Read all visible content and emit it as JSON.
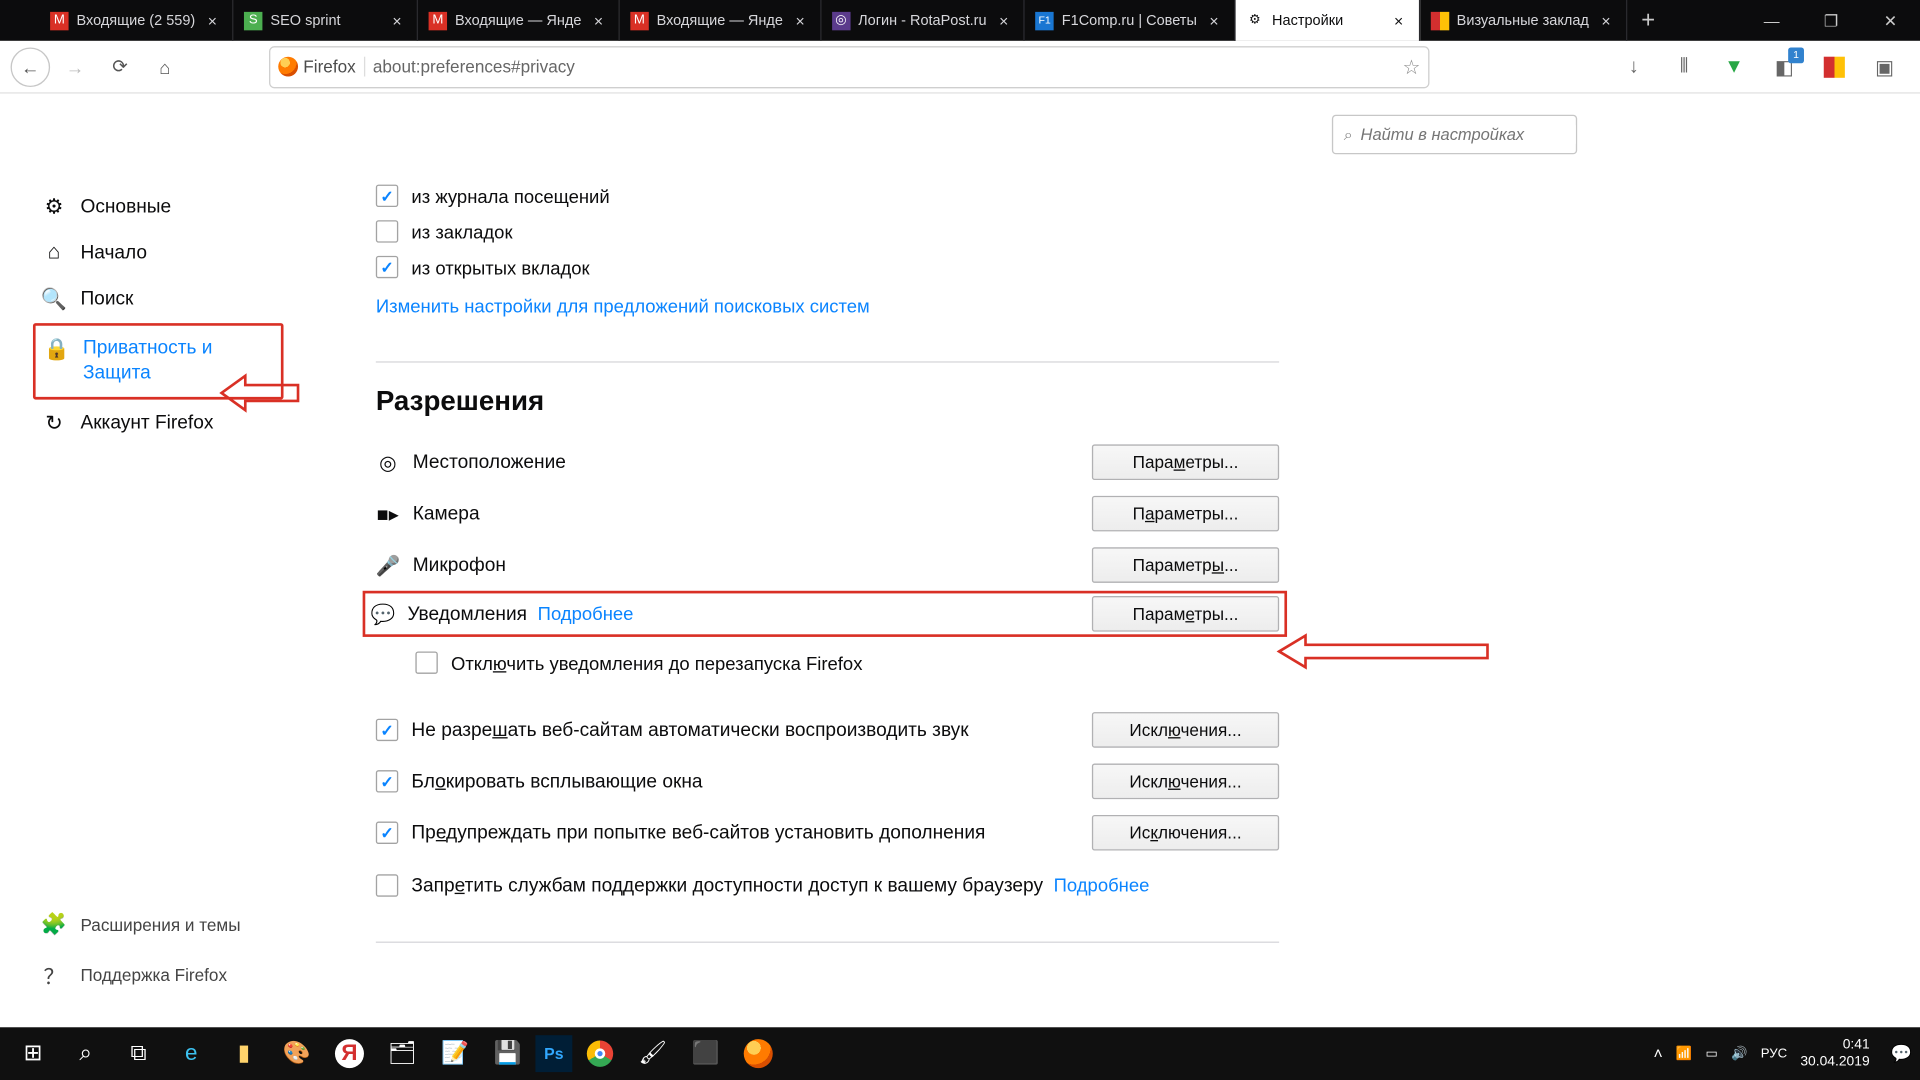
{
  "tabs": [
    {
      "label": "Входящие (2 559)",
      "favicon": "M",
      "fav_bg": "#d93025",
      "fav_color": "#fff"
    },
    {
      "label": "SEO sprint",
      "favicon": "S",
      "fav_bg": "#4caf50",
      "fav_color": "#fff"
    },
    {
      "label": "Входящие — Янде",
      "favicon": "M",
      "fav_bg": "#d93025",
      "fav_color": "#fff"
    },
    {
      "label": "Входящие — Янде",
      "favicon": "M",
      "fav_bg": "#d93025",
      "fav_color": "#fff"
    },
    {
      "label": "Логин - RotaPost.ru",
      "favicon": "◎",
      "fav_bg": "#5b3b8c",
      "fav_color": "#fff"
    },
    {
      "label": "F1Comp.ru | Советы",
      "favicon": "F1",
      "fav_bg": "#1976d2",
      "fav_color": "#fff"
    },
    {
      "label": "Настройки",
      "favicon": "⚙",
      "fav_bg": "#fff",
      "fav_color": "#555",
      "active": true
    },
    {
      "label": "Визуальные заклад",
      "favicon": "▮",
      "fav_bg": "#d32f2f",
      "fav_color": "#ffc107"
    }
  ],
  "urlbar": {
    "identity": "Firefox",
    "url": "about:preferences#privacy"
  },
  "search": {
    "placeholder": "Найти в настройках"
  },
  "sidebar": {
    "general": {
      "icon": "⚙",
      "label": "Основные"
    },
    "home": {
      "icon": "⌂",
      "label": "Начало"
    },
    "search": {
      "icon": "🔍",
      "label": "Поиск"
    },
    "privacy": {
      "icon": "🔒",
      "label": "Приватность и Защита"
    },
    "account": {
      "icon": "↻",
      "label": "Аккаунт Firefox"
    },
    "ext": {
      "icon": "🧩",
      "label": "Расширения и темы"
    },
    "support": {
      "icon": "？",
      "label": "Поддержка Firefox"
    }
  },
  "addressbar_section": {
    "history": "из журнала посещений",
    "bookmarks": "из закладок",
    "opentabs": "из открытых вкладок",
    "change_link": "Изменить настройки для предложений поисковых систем"
  },
  "permissions": {
    "heading": "Разрешения",
    "location": {
      "label": "Местоположение",
      "button": "Параметры..."
    },
    "camera": {
      "label": "Камера",
      "button": "Параметры..."
    },
    "microphone": {
      "label": "Микрофон",
      "button": "Параметры..."
    },
    "notifications": {
      "label": "Уведомления",
      "more": "Подробнее",
      "button": "Параметры..."
    },
    "notif_sub": "Отключить уведомления до перезапуска Firefox",
    "autoplay": {
      "label": "Не разрешать веб-сайтам автоматически воспроизводить звук",
      "button": "Исключения..."
    },
    "popups": {
      "label": "Блокировать всплывающие окна",
      "button": "Исключения..."
    },
    "addons": {
      "label": "Предупреждать при попытке веб-сайтов установить дополнения",
      "button": "Исключения..."
    },
    "accessibility": {
      "label": "Запретить службам поддержки доступности доступ к вашему браузеру",
      "more": "Подробнее"
    }
  },
  "systray": {
    "lang": "РУС",
    "time": "0:41",
    "date": "30.04.2019",
    "pocket_badge": "1"
  }
}
